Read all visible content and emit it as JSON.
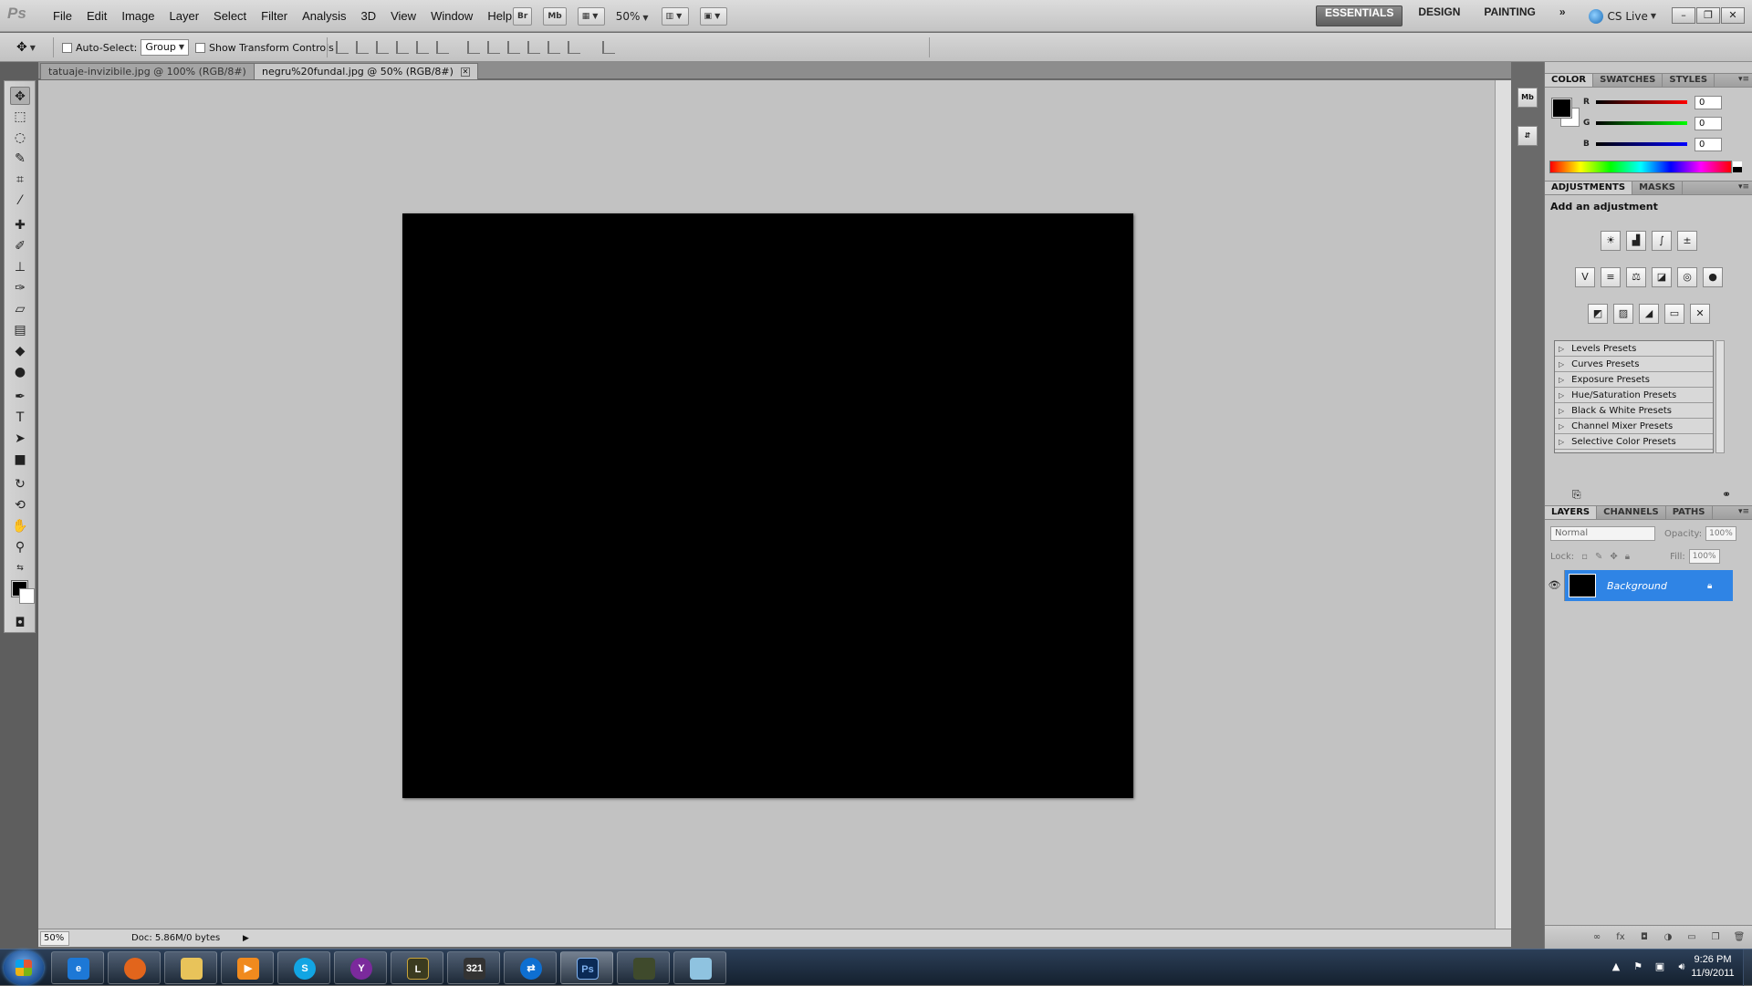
{
  "app": {
    "logo": "Ps"
  },
  "menu": [
    "File",
    "Edit",
    "Image",
    "Layer",
    "Select",
    "Filter",
    "Analysis",
    "3D",
    "View",
    "Window",
    "Help"
  ],
  "appbar": {
    "bridge": "Br",
    "minibridge": "Mb",
    "zoom": "50%"
  },
  "workspaces": {
    "essentials": "ESSENTIALS",
    "design": "DESIGN",
    "painting": "PAINTING",
    "more": "»",
    "cslive": "CS Live"
  },
  "options": {
    "autoselect_label": "Auto-Select:",
    "autoselect_value": "Group",
    "transform_label": "Show Transform Controls"
  },
  "documents": [
    {
      "title": "tatuaje-invizibile.jpg @ 100% (RGB/8#)",
      "active": false
    },
    {
      "title": "negru%20fundal.jpg @ 50% (RGB/8#)",
      "active": true
    }
  ],
  "status": {
    "zoom": "50%",
    "doc": "Doc: 5.86M/0 bytes"
  },
  "color_panel": {
    "tabs": [
      "COLOR",
      "SWATCHES",
      "STYLES"
    ],
    "r": {
      "label": "R",
      "value": "0"
    },
    "g": {
      "label": "G",
      "value": "0"
    },
    "b": {
      "label": "B",
      "value": "0"
    },
    "foreground": "#000000",
    "background": "#ffffff"
  },
  "adjustments": {
    "tabs": [
      "ADJUSTMENTS",
      "MASKS"
    ],
    "title": "Add an adjustment",
    "presets": [
      "Levels Presets",
      "Curves Presets",
      "Exposure Presets",
      "Hue/Saturation Presets",
      "Black & White Presets",
      "Channel Mixer Presets",
      "Selective Color Presets"
    ]
  },
  "layers": {
    "tabs": [
      "LAYERS",
      "CHANNELS",
      "PATHS"
    ],
    "blend": "Normal",
    "opacity_label": "Opacity:",
    "opacity": "100%",
    "lock_label": "Lock:",
    "fill_label": "Fill:",
    "fill": "100%",
    "items": [
      {
        "name": "Background",
        "selected": true,
        "locked": true
      }
    ]
  },
  "taskbar": {
    "time": "9:26 PM",
    "date": "11/9/2011",
    "apps": [
      "Internet Explorer",
      "Firefox",
      "Windows Explorer",
      "Media Player",
      "Skype",
      "Yahoo Messenger",
      "League of Legends",
      "321 Media",
      "TeamViewer",
      "Photoshop",
      "Call of Duty",
      "Notepad"
    ]
  }
}
